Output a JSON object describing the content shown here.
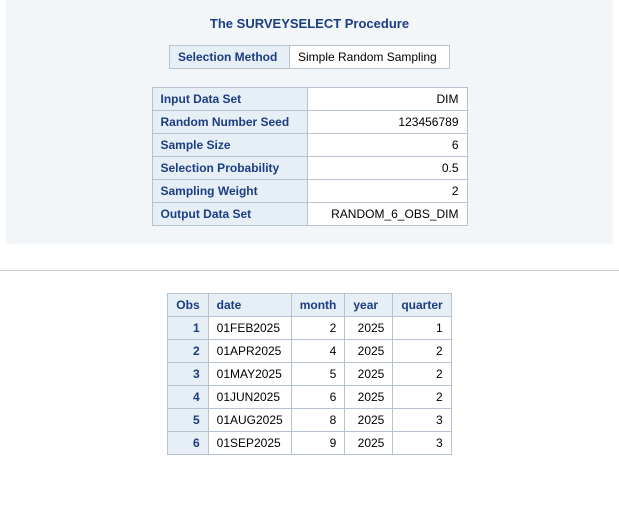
{
  "proc": {
    "title": "The SURVEYSELECT Procedure",
    "method_label": "Selection Method",
    "method_value": "Simple Random Sampling",
    "summary": [
      {
        "label": "Input Data Set",
        "value": "DIM"
      },
      {
        "label": "Random Number Seed",
        "value": "123456789"
      },
      {
        "label": "Sample Size",
        "value": "6"
      },
      {
        "label": "Selection Probability",
        "value": "0.5"
      },
      {
        "label": "Sampling Weight",
        "value": "2"
      },
      {
        "label": "Output Data Set",
        "value": "RANDOM_6_OBS_DIM"
      }
    ]
  },
  "result": {
    "columns": {
      "obs": "Obs",
      "date": "date",
      "month": "month",
      "year": "year",
      "quarter": "quarter"
    },
    "rows": [
      {
        "obs": "1",
        "date": "01FEB2025",
        "month": "2",
        "year": "2025",
        "quarter": "1"
      },
      {
        "obs": "2",
        "date": "01APR2025",
        "month": "4",
        "year": "2025",
        "quarter": "2"
      },
      {
        "obs": "3",
        "date": "01MAY2025",
        "month": "5",
        "year": "2025",
        "quarter": "2"
      },
      {
        "obs": "4",
        "date": "01JUN2025",
        "month": "6",
        "year": "2025",
        "quarter": "2"
      },
      {
        "obs": "5",
        "date": "01AUG2025",
        "month": "8",
        "year": "2025",
        "quarter": "3"
      },
      {
        "obs": "6",
        "date": "01SEP2025",
        "month": "9",
        "year": "2025",
        "quarter": "3"
      }
    ]
  }
}
